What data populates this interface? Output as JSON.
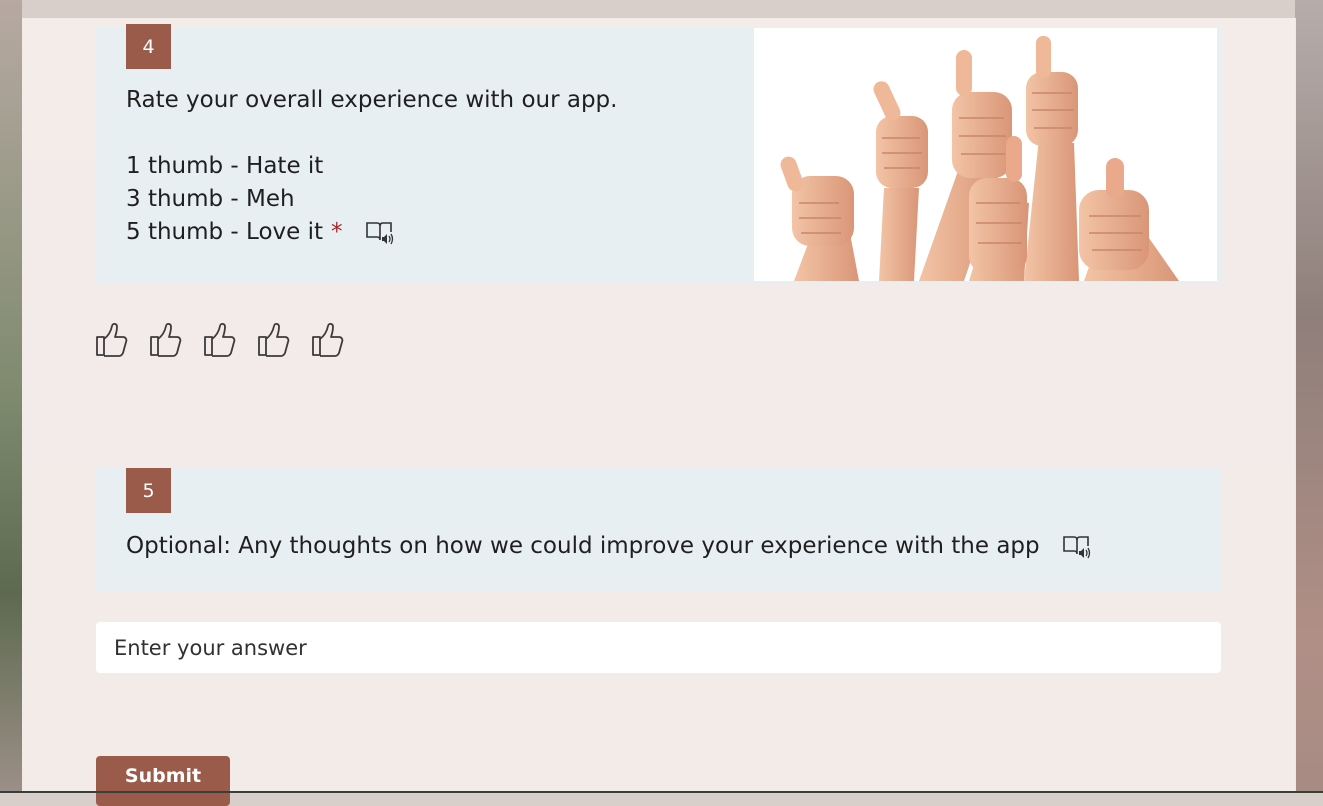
{
  "theme": {
    "accent": "#9a5b4b",
    "card_bg": "#e7eff2",
    "required": "#a4262c"
  },
  "question4": {
    "number": "4",
    "text": "Rate your overall experience with our app.\n\n1 thumb - Hate it\n3 thumb - Meh\n5 thumb - Love it",
    "required_mark": "*",
    "reader_icon": "immersive-reader-icon",
    "image": "thumbs-up-hands-image",
    "rating": {
      "max": 5,
      "selected": 0,
      "icon": "thumbs-up-outline-icon"
    }
  },
  "question5": {
    "number": "5",
    "text": "Optional: Any thoughts on how we could improve your experience with the app",
    "reader_icon": "immersive-reader-icon",
    "answer": {
      "placeholder": "Enter your answer",
      "value": ""
    }
  },
  "submit": {
    "label": "Submit"
  }
}
